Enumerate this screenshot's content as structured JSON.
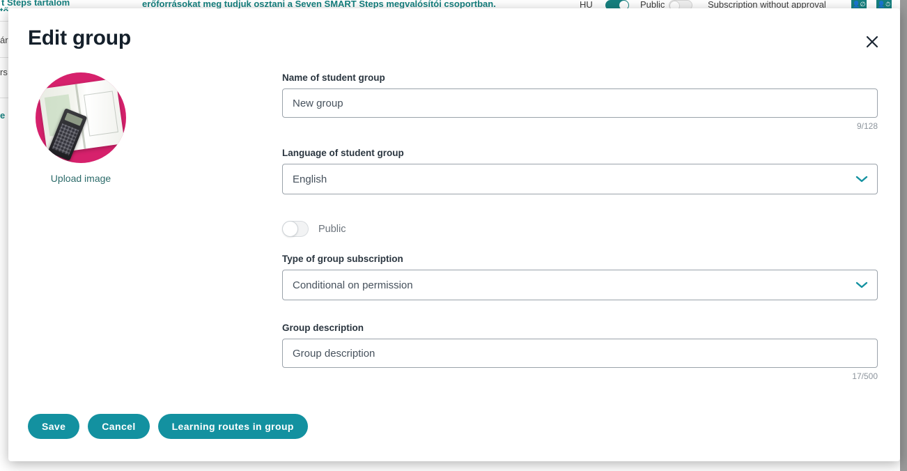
{
  "background": {
    "title_fragment_top": "t Steps tartalom",
    "title_fragment_second": "tő",
    "center_heading": "erőforrásokat meg tudjuk osztani a Seven SMART Steps megvalósítói csoportban.",
    "language_code": "HU",
    "public_label": "Public",
    "subscription_label": "Subscription without approval",
    "left_fragments": [
      "ár",
      "rs",
      "e"
    ],
    "icons": [
      "user-remove-icon",
      "user-clock-icon",
      "document-icon",
      "user-add-icon",
      "user-edit-icon"
    ]
  },
  "modal": {
    "title": "Edit group",
    "close_icon": "close-icon",
    "avatar": {
      "alt": "group-avatar-book-calculator",
      "upload_label": "Upload image"
    },
    "fields": {
      "name": {
        "label": "Name of student group",
        "value": "New group",
        "placeholder": "Name of student group",
        "counter": "9/128"
      },
      "language": {
        "label": "Language of student group",
        "value": "English",
        "chevron_icon": "chevron-down-icon"
      },
      "public_toggle": {
        "label": "Public",
        "state": "off"
      },
      "subscription": {
        "label": "Type of group subscription",
        "value": "Conditional on permission",
        "chevron_icon": "chevron-down-icon"
      },
      "description": {
        "label": "Group description",
        "value": "Group description",
        "placeholder": "Group description",
        "counter": "17/500"
      }
    },
    "buttons": {
      "save": "Save",
      "cancel": "Cancel",
      "routes": "Learning routes in group"
    }
  },
  "colors": {
    "accent_teal": "#1391a0",
    "brand_teal": "#16807f",
    "avatar_pink": "#d6216c",
    "title_dark": "#15202b"
  }
}
